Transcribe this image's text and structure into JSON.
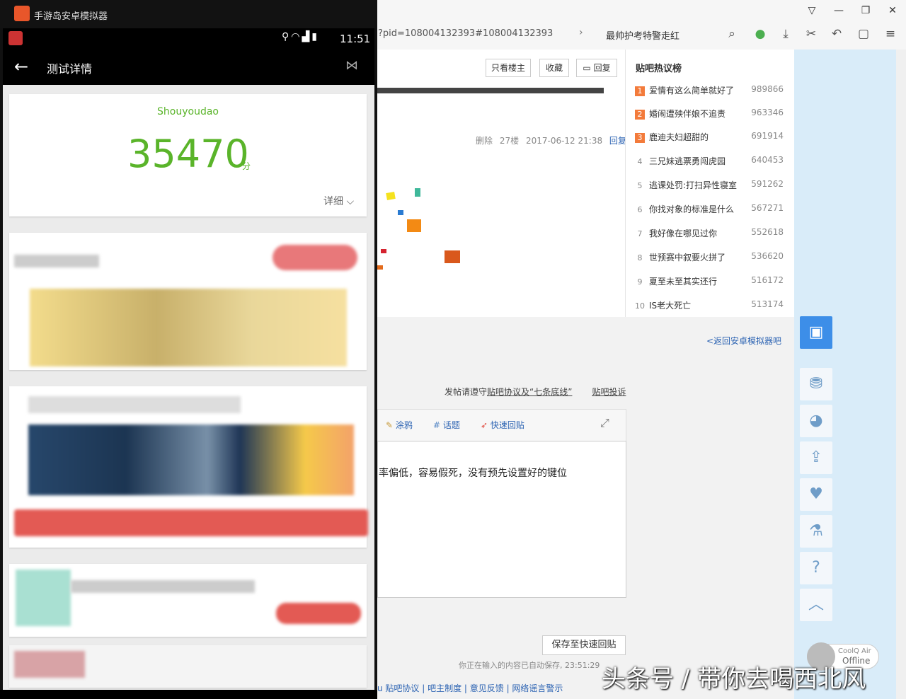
{
  "emulator": {
    "window_title": "手游岛安卓模拟器",
    "status_time": "11:51",
    "header_title": "测试详情",
    "brand": "Shouyoudao",
    "score": "35470",
    "score_unit": "分",
    "detail_label": "详细 ⌵"
  },
  "browser": {
    "url": "?pid=108004132393#108004132393",
    "search_query": "最帅护考特警走红"
  },
  "post": {
    "buttons": [
      "只看楼主",
      "收藏",
      "回复"
    ],
    "floor_meta": [
      "删除",
      "27楼",
      "2017-06-12 21:38"
    ],
    "floor_reply": "回复"
  },
  "hot_list": {
    "title": "贴吧热议榜",
    "items": [
      {
        "rank": "1",
        "name": "爱情有这么简单就好了",
        "count": "989866"
      },
      {
        "rank": "2",
        "name": "婚闹遭殃伴娘不追责",
        "count": "963346"
      },
      {
        "rank": "3",
        "name": "鹿迪夫妇超甜的",
        "count": "691914"
      },
      {
        "rank": "4",
        "name": "三兄妹逃票勇闯虎园",
        "count": "640453"
      },
      {
        "rank": "5",
        "name": "逃课处罚:打扫异性寝室",
        "count": "591262"
      },
      {
        "rank": "6",
        "name": "你找对象的标准是什么",
        "count": "567271"
      },
      {
        "rank": "7",
        "name": "我好像在哪见过你",
        "count": "552618"
      },
      {
        "rank": "8",
        "name": "世预赛中叙要火拼了",
        "count": "536620"
      },
      {
        "rank": "9",
        "name": "夏至未至其实还行",
        "count": "516172"
      },
      {
        "rank": "10",
        "name": "IS老大死亡",
        "count": "513174"
      }
    ]
  },
  "back_link": "<返回安卓模拟器吧",
  "rules": {
    "prefix": "发帖请遵守",
    "link1": "贴吧协议及“七条底线”",
    "link2": "贴吧投诉"
  },
  "editor": {
    "tools": [
      "涂鸦",
      "话题",
      "快速回贴"
    ],
    "text": "率偏低，容易假死，没有预先设置好的键位",
    "save_label": "保存至快速回贴",
    "autosave": "你正在输入的内容已自动保存, 23:51:29"
  },
  "footer_links": "u 贴吧协议 | 吧主制度 | 意见反馈 | 网络谣言警示",
  "coolq": {
    "name": "CoolQ Air",
    "status": "Offline"
  },
  "watermark": "头条号 / 带你去喝西北风",
  "colors": {
    "accent_green": "#5ab42a",
    "link_blue": "#2d64b3",
    "chat_blue": "#3d8ee8",
    "rank_orange": "#f37b3b"
  }
}
